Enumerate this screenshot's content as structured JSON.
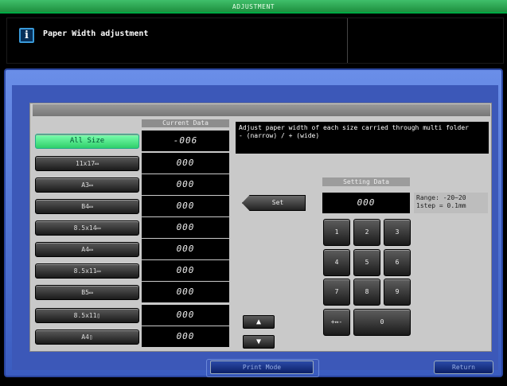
{
  "window": {
    "title": "ADJUSTMENT"
  },
  "message": {
    "icon": "info-icon",
    "text": "Paper Width adjustment"
  },
  "sizes": [
    {
      "label": "All Size",
      "value": "-006",
      "active": true
    },
    {
      "label": "11x17▭",
      "value": "000"
    },
    {
      "label": "A3▭",
      "value": "000"
    },
    {
      "label": "B4▭",
      "value": "000"
    },
    {
      "label": "8.5x14▭",
      "value": "000"
    },
    {
      "label": "A4▭",
      "value": "000"
    },
    {
      "label": "8.5x11▭",
      "value": "000"
    },
    {
      "label": "B5▭",
      "value": "000"
    },
    {
      "label": "8.5x11▯",
      "value": "000"
    },
    {
      "label": "A4▯",
      "value": "000"
    }
  ],
  "current_data": {
    "header": "Current Data"
  },
  "description": {
    "line1": "Adjust paper width of each size carried through multi folder",
    "line2": "- (narrow) / + (wide)"
  },
  "set_button": {
    "label": "Set"
  },
  "setting_data": {
    "header": "Setting Data",
    "value": "000",
    "range_label": "Range:  -20~20",
    "step_label": "1step = 0.1mm"
  },
  "keypad": {
    "keys": [
      "1",
      "2",
      "3",
      "4",
      "5",
      "6",
      "7",
      "8",
      "9"
    ],
    "sign": "+↔-",
    "zero": "0"
  },
  "arrows": {
    "up": "▲",
    "down": "▼"
  },
  "bottom": {
    "print_mode": "Print Mode",
    "return": "Return"
  },
  "colors": {
    "active": "#3fdc7a",
    "frame": "#4a6ad0",
    "title": "#2aa84f"
  }
}
